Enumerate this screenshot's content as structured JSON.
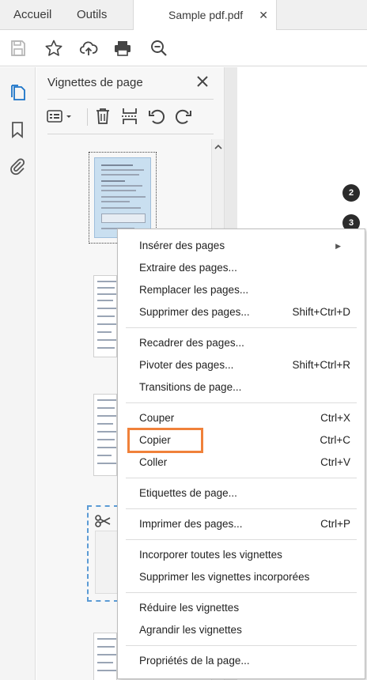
{
  "tabs": {
    "home": "Accueil",
    "tools": "Outils",
    "document": "Sample pdf.pdf",
    "close_symbol": "✕"
  },
  "toolbar": {
    "icons": [
      "save-icon",
      "star-icon",
      "cloud-upload-icon",
      "print-icon",
      "zoom-out-icon"
    ]
  },
  "rail": {
    "icons": [
      "page-thumbnails-icon",
      "bookmark-icon",
      "attachment-icon"
    ]
  },
  "panel": {
    "title": "Vignettes de page",
    "close_symbol": "✕",
    "tools": [
      "options-menu-icon",
      "delete-icon",
      "insert-page-icon",
      "rotate-left-icon",
      "rotate-right-icon"
    ]
  },
  "document": {
    "page_badges": [
      "2",
      "3"
    ]
  },
  "context_menu": {
    "items": [
      {
        "label": "Insérer des pages",
        "shortcut": "",
        "submenu": true
      },
      {
        "label": "Extraire des pages...",
        "shortcut": ""
      },
      {
        "label": "Remplacer les pages...",
        "shortcut": ""
      },
      {
        "label": "Supprimer des pages...",
        "shortcut": "Shift+Ctrl+D"
      },
      {
        "label": "Recadrer des pages...",
        "shortcut": ""
      },
      {
        "label": "Pivoter des pages...",
        "shortcut": "Shift+Ctrl+R"
      },
      {
        "label": "Transitions de page...",
        "shortcut": ""
      },
      {
        "label": "Couper",
        "shortcut": "Ctrl+X"
      },
      {
        "label": "Copier",
        "shortcut": "Ctrl+C",
        "highlighted": true
      },
      {
        "label": "Coller",
        "shortcut": "Ctrl+V"
      },
      {
        "label": "Etiquettes de page...",
        "shortcut": ""
      },
      {
        "label": "Imprimer des pages...",
        "shortcut": "Ctrl+P"
      },
      {
        "label": "Incorporer toutes les vignettes",
        "shortcut": ""
      },
      {
        "label": "Supprimer les vignettes incorporées",
        "shortcut": ""
      },
      {
        "label": "Réduire les vignettes",
        "shortcut": ""
      },
      {
        "label": "Agrandir les vignettes",
        "shortcut": ""
      },
      {
        "label": "Propriétés de la page...",
        "shortcut": ""
      }
    ],
    "submenu_arrow": "▶"
  },
  "colors": {
    "highlight": "#f0813a",
    "selection": "#c9dff0",
    "cut_dash": "#5b9bd5"
  }
}
